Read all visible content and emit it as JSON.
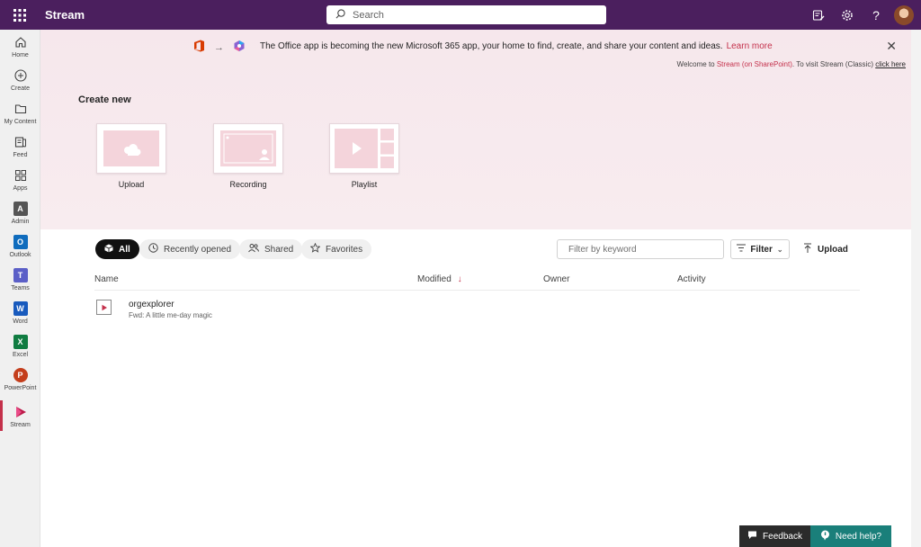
{
  "topbar": {
    "app_title": "Stream",
    "search_placeholder": "Search",
    "icons": [
      "waffle-icon",
      "whats-new-icon",
      "settings-icon",
      "help-icon",
      "avatar"
    ]
  },
  "rail": {
    "items": [
      {
        "label": "Home",
        "icon": "home-icon"
      },
      {
        "label": "Create",
        "icon": "add-circle-icon"
      },
      {
        "label": "My Content",
        "icon": "folder-icon"
      },
      {
        "label": "Feed",
        "icon": "feed-icon"
      },
      {
        "label": "Apps",
        "icon": "apps-icon"
      },
      {
        "label": "Admin",
        "icon": "admin-icon"
      },
      {
        "label": "Outlook",
        "icon": "outlook-icon"
      },
      {
        "label": "Teams",
        "icon": "teams-icon"
      },
      {
        "label": "Word",
        "icon": "word-icon"
      },
      {
        "label": "Excel",
        "icon": "excel-icon"
      },
      {
        "label": "PowerPoint",
        "icon": "powerpoint-icon"
      },
      {
        "label": "Stream",
        "icon": "stream-icon"
      }
    ],
    "active": "Stream"
  },
  "banner": {
    "text": "The Office app is becoming the new Microsoft 365 app, your home to find, create, and share your content and ideas.",
    "link": "Learn more",
    "welcome_prefix": "Welcome to ",
    "welcome_accent": "Stream (on SharePoint)",
    "welcome_mid": ". To visit Stream (Classic) ",
    "welcome_link": "click here"
  },
  "create_new": {
    "heading": "Create new",
    "cards": [
      "Upload",
      "Recording",
      "Playlist"
    ]
  },
  "filters": {
    "pills": [
      "All",
      "Recently opened",
      "Shared",
      "Favorites"
    ],
    "active": "All",
    "keyword_placeholder": "Filter by keyword",
    "filter_label": "Filter",
    "upload_label": "Upload"
  },
  "table": {
    "columns": [
      "Name",
      "Modified",
      "Owner",
      "Activity"
    ],
    "sort_column": "Modified",
    "rows": [
      {
        "name": "orgexplorer",
        "subtitle": "Fwd: A little me-day magic"
      }
    ]
  },
  "bottom": {
    "feedback": "Feedback",
    "need_help": "Need help?"
  },
  "colors": {
    "topbar": "#4b1f5e",
    "accent": "#c4314b",
    "hero": "#f6e7ec",
    "help": "#1a7f7a"
  }
}
